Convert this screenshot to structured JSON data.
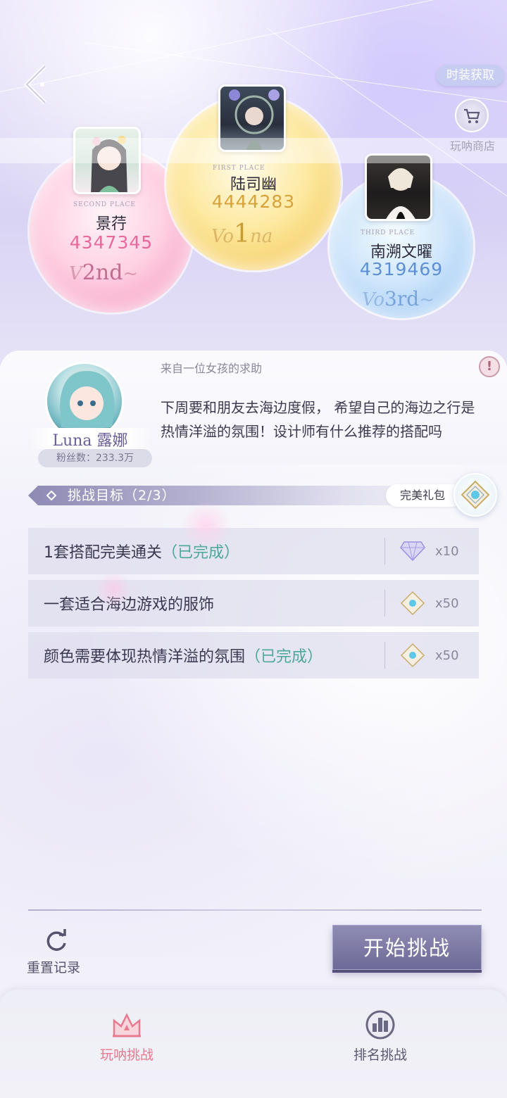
{
  "header": {
    "fashion_button": "时装获取",
    "shop_label": "玩呐商店"
  },
  "podium": [
    {
      "place_tag": "SECOND PLACE",
      "name": "景荇",
      "score": "4347345",
      "rank_mark": "2nd",
      "color": "#e9679a"
    },
    {
      "place_tag": "FIRST PLACE",
      "name": "陆司幽",
      "score": "4444283",
      "rank_mark": "1",
      "color": "#d8a23a"
    },
    {
      "place_tag": "THIRD PLACE",
      "name": "南溯文曜",
      "score": "4319469",
      "rank_mark": "3rd",
      "color": "#5d8fd6"
    }
  ],
  "request": {
    "from": "来自一位女孩的求助",
    "text": "下周要和朋友去海边度假， 希望自己的海边之行是热情洋溢的氛围！设计师有什么推荐的搭配吗",
    "client_name": "Luna 露娜",
    "fans": "粉丝数：233.3万"
  },
  "goals": {
    "title": "挑战目标（2/3）",
    "gift_label": "完美礼包",
    "items": [
      {
        "text": "1套搭配完美通关",
        "status": "（已完成）",
        "reward_icon": "diamond-icon",
        "count": "x10"
      },
      {
        "text": "一套适合海边游戏的服饰",
        "status": "",
        "reward_icon": "crystal-badge-icon",
        "count": "x50"
      },
      {
        "text": "颜色需要体现热情洋溢的氛围",
        "status": "（已完成）",
        "reward_icon": "crystal-badge-icon",
        "count": "x50"
      }
    ]
  },
  "actions": {
    "reset_label": "重置记录",
    "start_label": "开始挑战"
  },
  "nav": {
    "tab1": "玩呐挑战",
    "tab2": "排名挑战",
    "active_color": "#e8798f",
    "inactive_color": "#5b5872"
  }
}
